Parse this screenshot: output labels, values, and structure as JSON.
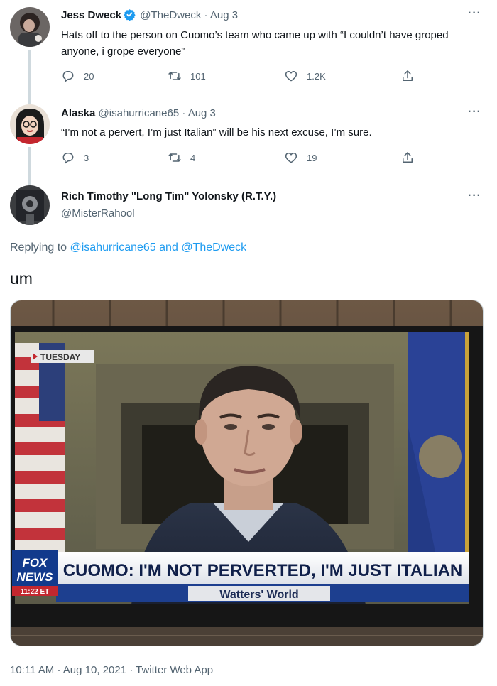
{
  "colors": {
    "accent": "#1d9bf0",
    "text": "#0f1419",
    "muted": "#536471",
    "thread_line": "#cfd9de"
  },
  "tweets": [
    {
      "name": "Jess Dweck",
      "verified": true,
      "handle": "@TheDweck",
      "separator": "·",
      "date": "Aug 3",
      "text": "Hats off to the person on Cuomo’s team who came up with “I couldn’t have groped anyone, i grope everyone”",
      "replies": "20",
      "retweets": "101",
      "likes": "1.2K"
    },
    {
      "name": "Alaska",
      "handle": "@isahurricane65",
      "separator": "·",
      "date": "Aug 3",
      "text": "“I’m not a pervert, I’m just Italian” will be his next excuse, I’m sure.",
      "replies": "3",
      "retweets": "4",
      "likes": "19"
    }
  ],
  "main_tweet": {
    "name": "Rich Timothy \"Long Tim\" Yolonsky (R.T.Y.)",
    "handle": "@MisterRahool",
    "replying_prefix": "Replying to",
    "replying_user1": "@isahurricane65",
    "replying_and": "and",
    "replying_user2": "@TheDweck",
    "text": "um",
    "media": {
      "tv_tag": "TUESDAY",
      "network_line1": "FOX",
      "network_line2": "NEWS",
      "time_tag": "11:22 ET",
      "headline": "CUOMO: I'M NOT PERVERTED, I'M JUST ITALIAN",
      "show_name": "Watters' World"
    },
    "time": "10:11 AM",
    "separator": "·",
    "date": "Aug 10, 2021",
    "separator2": "·",
    "source": "Twitter Web App"
  },
  "icons": {
    "more": "more-icon",
    "reply": "reply-icon",
    "retweet": "retweet-icon",
    "like": "like-icon",
    "share": "share-icon",
    "verified": "verified-badge-icon"
  }
}
